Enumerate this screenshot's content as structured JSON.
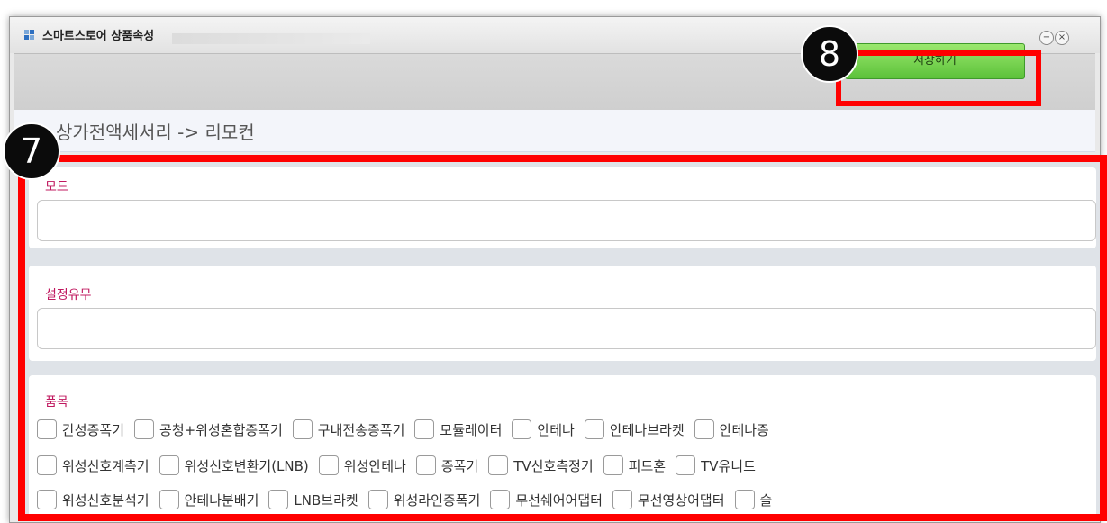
{
  "window": {
    "title": "스마트스토어 상품속성",
    "minimize_glyph": "−",
    "close_glyph": "×"
  },
  "toolbar": {
    "save_label": "저장하기"
  },
  "badges": {
    "save": "8",
    "form": "7"
  },
  "breadcrumb": "상가전액세서리 -> 리모컨",
  "form": {
    "mode": {
      "label": "모드",
      "value": ""
    },
    "setting": {
      "label": "설정유무",
      "value": ""
    },
    "items": {
      "label": "품목",
      "rows": [
        [
          "간성증폭기",
          "공청+위성혼합증폭기",
          "구내전송증폭기",
          "모듈레이터",
          "안테나",
          "안테나브라켓",
          "안테나증"
        ],
        [
          "위성신호계측기",
          "위성신호변환기(LNB)",
          "위성안테나",
          "증폭기",
          "TV신호측정기",
          "피드혼",
          "TV유니트"
        ],
        [
          "위성신호분석기",
          "안테나분배기",
          "LNB브라켓",
          "위성라인증폭기",
          "무선쉐어어댑터",
          "무선영상어댑터",
          "슬"
        ]
      ]
    }
  },
  "colors": {
    "highlight": "#ff0000",
    "label_accent": "#c0185f",
    "save_green": "#5cc23a"
  },
  "icons": {
    "app": "windows-tile-icon",
    "minimize": "minimize-icon",
    "close": "close-icon"
  }
}
